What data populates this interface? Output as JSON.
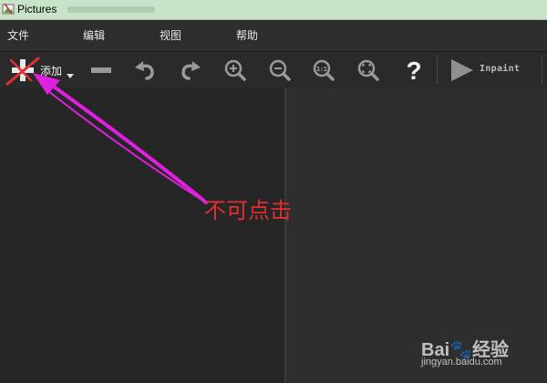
{
  "window": {
    "title": "Pictures"
  },
  "menu": {
    "items": [
      "文件",
      "编辑",
      "视图",
      "帮助"
    ]
  },
  "toolbar": {
    "add_label": "添加",
    "inpaint_label": "Inpaint",
    "buttons": [
      {
        "name": "add-button",
        "icon": "plus-icon"
      },
      {
        "name": "remove-button",
        "icon": "minus-icon"
      },
      {
        "name": "undo-button",
        "icon": "undo-icon"
      },
      {
        "name": "redo-button",
        "icon": "redo-icon"
      },
      {
        "name": "zoom-in-button",
        "icon": "zoom-in-icon"
      },
      {
        "name": "zoom-out-button",
        "icon": "zoom-out-icon"
      },
      {
        "name": "actual-size-button",
        "icon": "zoom-actual-size-icon",
        "glyph": "1:1"
      },
      {
        "name": "fit-window-button",
        "icon": "zoom-fit-icon"
      },
      {
        "name": "help-button",
        "icon": "help-icon",
        "glyph": "?"
      },
      {
        "name": "inpaint-button",
        "icon": "play-icon"
      }
    ]
  },
  "annotation": {
    "text": "不可点击",
    "color": "#e03030",
    "arrow_color": "#e020e0"
  },
  "watermark": {
    "logo_text": "Bai🐾经验",
    "url": "jingyan.baidu.com"
  },
  "colors": {
    "titlebar": "#c8e3c8",
    "menubar": "#2d2d2d",
    "toolbar": "#2a2a2a",
    "canvas_left": "#262626",
    "canvas_right": "#2e2e2e"
  }
}
